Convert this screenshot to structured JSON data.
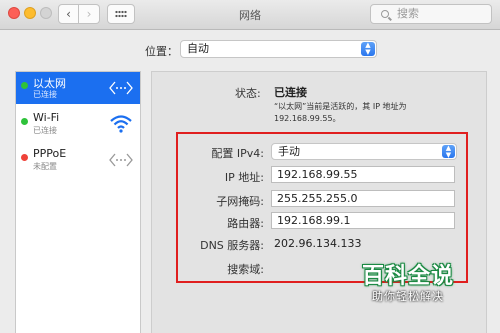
{
  "window": {
    "title": "网络"
  },
  "toolbar": {
    "back_glyph": "‹",
    "forward_glyph": "›",
    "search_placeholder": "搜索"
  },
  "location": {
    "label": "位置：",
    "value": "自动"
  },
  "services": [
    {
      "name": "以太网",
      "status": "已连接",
      "status_color": "#2fc23a",
      "icon": "ethernet-icon",
      "selected": true
    },
    {
      "name": "Wi-Fi",
      "status": "已连接",
      "status_color": "#2fc23a",
      "icon": "wifi-icon",
      "selected": false
    },
    {
      "name": "PPPoE",
      "status": "未配置",
      "status_color": "#ef4239",
      "icon": "ethernet-icon",
      "selected": false
    }
  ],
  "detail": {
    "status_label": "状态:",
    "status_value": "已连接",
    "status_desc": "“以太网”当前是活跃的，其 IP 地址为 192.168.99.55。",
    "configure_label": "配置 IPv4:",
    "configure_value": "手动",
    "ip_label": "IP 地址:",
    "ip_value": "192.168.99.55",
    "mask_label": "子网掩码:",
    "mask_value": "255.255.255.0",
    "router_label": "路由器:",
    "router_value": "192.168.99.1",
    "dns_label": "DNS 服务器:",
    "dns_value": "202.96.134.133",
    "search_domain_label": "搜索域:"
  },
  "watermark": {
    "title": "百科全说",
    "subtitle": "助你轻松解决"
  },
  "colors": {
    "accent": "#1b6ff0",
    "highlight_box": "#e01f1f",
    "connected": "#2fc23a",
    "not_configured": "#ef4239"
  }
}
